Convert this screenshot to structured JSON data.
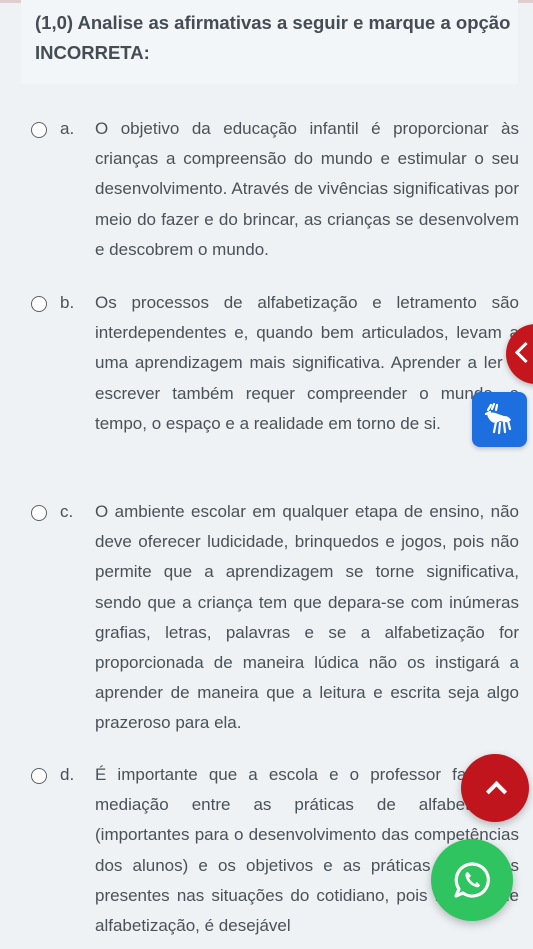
{
  "question": {
    "text": "(1,0) Analise as afirmativas a seguir e marque a opção INCORRETA:"
  },
  "answers": [
    {
      "letter": "a.",
      "text": "O objetivo da educação infantil é proporcionar às crianças a compreensão do mundo e estimular o seu desenvolvimento. Através de vivências significativas por meio do fazer e do brincar, as crianças se desenvolvem e descobrem o mundo.",
      "selected": false
    },
    {
      "letter": "b.",
      "text": "Os processos de alfabetização e letramento são interdependentes e, quando bem articulados, levam a uma aprendizagem mais significativa. Aprender a ler e escrever também requer compreender o mundo, o tempo, o espaço e a realidade em torno de si.",
      "selected": false
    },
    {
      "letter": "c.",
      "text": "O ambiente escolar em qualquer etapa de ensino, não deve oferecer ludicidade, brinquedos e jogos, pois não permite que a aprendizagem se torne significativa, sendo que a criança tem que depara-se com inúmeras grafias, letras, palavras e se a alfabetização for proporcionada de maneira lúdica não os instigará a aprender de maneira que a leitura e escrita seja algo prazeroso para ela.",
      "selected": false
    },
    {
      "letter": "d.",
      "text": "É importante que a escola e o professor façam a mediação entre as práticas de alfabetização (importantes para o desenvolvimento das competências dos alunos) e os objetivos e as práticas relevantes presentes nas situações do cotidiano, pois na fase de alfabetização, é desejável",
      "selected": false
    }
  ],
  "floating": {
    "collapse_icon": "chevron-left-icon",
    "accessibility_icon": "sign-language-hands-icon",
    "scroll_top_icon": "chevron-up-icon",
    "whatsapp_icon": "whatsapp-icon"
  },
  "colors": {
    "accent_red": "#c5161d",
    "libras_blue": "#1d6fe0",
    "whatsapp_green": "#2fc45f"
  }
}
